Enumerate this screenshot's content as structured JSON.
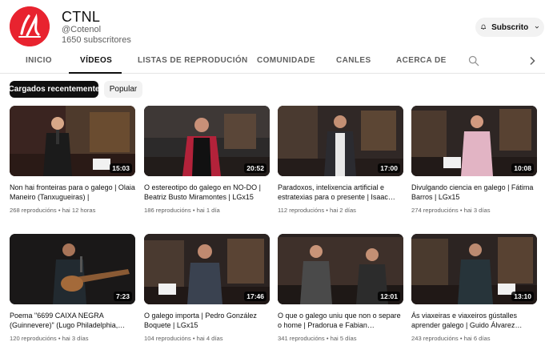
{
  "channel": {
    "name": "CTNL",
    "handle": "@Cotenol",
    "subscribers": "1650 subscritores",
    "brand_color": "#e8232f"
  },
  "subscribe": {
    "label": "Subscrito",
    "icon": "bell-icon"
  },
  "tabs": [
    {
      "label": "INICIO",
      "active": false
    },
    {
      "label": "VÍDEOS",
      "active": true
    },
    {
      "label": "LISTAS DE REPRODUCIÓN",
      "active": false
    },
    {
      "label": "COMUNIDADE",
      "active": false
    },
    {
      "label": "CANLES",
      "active": false
    },
    {
      "label": "ACERCA DE",
      "active": false
    }
  ],
  "chips": [
    {
      "label": "Cargados recentemente",
      "selected": true
    },
    {
      "label": "Popular",
      "selected": false
    }
  ],
  "videos": [
    {
      "title": "Non hai fronteiras para o galego | Olaia Maneiro (Tanxugueiras) |",
      "duration": "15:03",
      "views": "268 reproducións",
      "age": "hai 12 horas"
    },
    {
      "title": "O estereotipo do galego en NO-DO | Beatriz Busto Miramontes | LGx15",
      "duration": "20:52",
      "views": "186 reproducións",
      "age": "hai 1 día"
    },
    {
      "title": "Paradoxos, intelixencia artificial e estratexias para o presente | Isaac…",
      "duration": "17:00",
      "views": "112 reproducións",
      "age": "hai 2 días"
    },
    {
      "title": "Divulgando ciencia en galego | Fátima Barros | LGx15",
      "duration": "10:08",
      "views": "274 reproducións",
      "age": "hai 3 días"
    },
    {
      "title": "Poema \"6699 CAIXA NEGRA (Guinnevere)\" (Lugo Philadelphia,…",
      "duration": "7:23",
      "views": "120 reproducións",
      "age": "hai 3 días"
    },
    {
      "title": "O galego importa | Pedro González Boquete | LGx15",
      "duration": "17:46",
      "views": "104 reproducións",
      "age": "hai 4 días"
    },
    {
      "title": "O que o galego uniu que non o separe o home | Pradorua e Fabian…",
      "duration": "12:01",
      "views": "341 reproducións",
      "age": "hai 5 días"
    },
    {
      "title": "Ás viaxeiras e viaxeiros gústalles aprender galego | Guido Álvarez…",
      "duration": "13:10",
      "views": "243 reproducións",
      "age": "hai 6 días"
    }
  ],
  "meta_separator": "•"
}
